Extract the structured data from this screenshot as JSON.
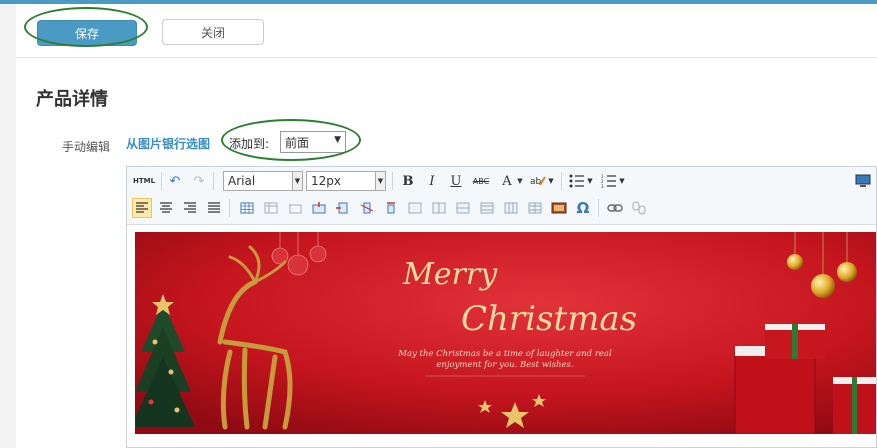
{
  "actions": {
    "save_label": "保存",
    "close_label": "关闭"
  },
  "section": {
    "title": "产品详情"
  },
  "editor_field": {
    "label": "手动编辑",
    "pick_from_bank": "从图片银行选图",
    "add_to_label": "添加到:",
    "add_to_value": "前面"
  },
  "toolbar": {
    "html_label": "HTML",
    "font_family": "Arial",
    "font_size": "12px",
    "bold": "B",
    "italic": "I",
    "underline": "U",
    "strike": "ABC",
    "font_color": "A",
    "special_char": "Ω"
  },
  "banner": {
    "headline_1": "Merry",
    "headline_2": "Christmas",
    "message_1": "May the Christmas be a time of laughter and real",
    "message_2": "enjoyment for you. Best wishes."
  },
  "colors": {
    "accent": "#4a9ac4",
    "banner_red": "#c8141c",
    "gold": "#e8c46a"
  }
}
